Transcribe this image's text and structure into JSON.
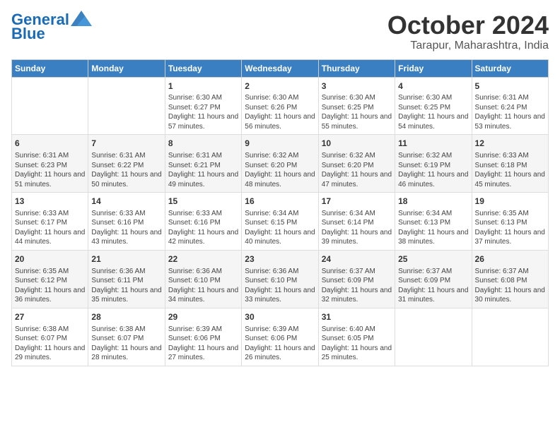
{
  "logo": {
    "line1": "General",
    "line2": "Blue"
  },
  "title": "October 2024",
  "subtitle": "Tarapur, Maharashtra, India",
  "weekdays": [
    "Sunday",
    "Monday",
    "Tuesday",
    "Wednesday",
    "Thursday",
    "Friday",
    "Saturday"
  ],
  "weeks": [
    [
      {
        "day": "",
        "data": ""
      },
      {
        "day": "",
        "data": ""
      },
      {
        "day": "1",
        "data": "Sunrise: 6:30 AM\nSunset: 6:27 PM\nDaylight: 11 hours and 57 minutes."
      },
      {
        "day": "2",
        "data": "Sunrise: 6:30 AM\nSunset: 6:26 PM\nDaylight: 11 hours and 56 minutes."
      },
      {
        "day": "3",
        "data": "Sunrise: 6:30 AM\nSunset: 6:25 PM\nDaylight: 11 hours and 55 minutes."
      },
      {
        "day": "4",
        "data": "Sunrise: 6:30 AM\nSunset: 6:25 PM\nDaylight: 11 hours and 54 minutes."
      },
      {
        "day": "5",
        "data": "Sunrise: 6:31 AM\nSunset: 6:24 PM\nDaylight: 11 hours and 53 minutes."
      }
    ],
    [
      {
        "day": "6",
        "data": "Sunrise: 6:31 AM\nSunset: 6:23 PM\nDaylight: 11 hours and 51 minutes."
      },
      {
        "day": "7",
        "data": "Sunrise: 6:31 AM\nSunset: 6:22 PM\nDaylight: 11 hours and 50 minutes."
      },
      {
        "day": "8",
        "data": "Sunrise: 6:31 AM\nSunset: 6:21 PM\nDaylight: 11 hours and 49 minutes."
      },
      {
        "day": "9",
        "data": "Sunrise: 6:32 AM\nSunset: 6:20 PM\nDaylight: 11 hours and 48 minutes."
      },
      {
        "day": "10",
        "data": "Sunrise: 6:32 AM\nSunset: 6:20 PM\nDaylight: 11 hours and 47 minutes."
      },
      {
        "day": "11",
        "data": "Sunrise: 6:32 AM\nSunset: 6:19 PM\nDaylight: 11 hours and 46 minutes."
      },
      {
        "day": "12",
        "data": "Sunrise: 6:33 AM\nSunset: 6:18 PM\nDaylight: 11 hours and 45 minutes."
      }
    ],
    [
      {
        "day": "13",
        "data": "Sunrise: 6:33 AM\nSunset: 6:17 PM\nDaylight: 11 hours and 44 minutes."
      },
      {
        "day": "14",
        "data": "Sunrise: 6:33 AM\nSunset: 6:16 PM\nDaylight: 11 hours and 43 minutes."
      },
      {
        "day": "15",
        "data": "Sunrise: 6:33 AM\nSunset: 6:16 PM\nDaylight: 11 hours and 42 minutes."
      },
      {
        "day": "16",
        "data": "Sunrise: 6:34 AM\nSunset: 6:15 PM\nDaylight: 11 hours and 40 minutes."
      },
      {
        "day": "17",
        "data": "Sunrise: 6:34 AM\nSunset: 6:14 PM\nDaylight: 11 hours and 39 minutes."
      },
      {
        "day": "18",
        "data": "Sunrise: 6:34 AM\nSunset: 6:13 PM\nDaylight: 11 hours and 38 minutes."
      },
      {
        "day": "19",
        "data": "Sunrise: 6:35 AM\nSunset: 6:13 PM\nDaylight: 11 hours and 37 minutes."
      }
    ],
    [
      {
        "day": "20",
        "data": "Sunrise: 6:35 AM\nSunset: 6:12 PM\nDaylight: 11 hours and 36 minutes."
      },
      {
        "day": "21",
        "data": "Sunrise: 6:36 AM\nSunset: 6:11 PM\nDaylight: 11 hours and 35 minutes."
      },
      {
        "day": "22",
        "data": "Sunrise: 6:36 AM\nSunset: 6:10 PM\nDaylight: 11 hours and 34 minutes."
      },
      {
        "day": "23",
        "data": "Sunrise: 6:36 AM\nSunset: 6:10 PM\nDaylight: 11 hours and 33 minutes."
      },
      {
        "day": "24",
        "data": "Sunrise: 6:37 AM\nSunset: 6:09 PM\nDaylight: 11 hours and 32 minutes."
      },
      {
        "day": "25",
        "data": "Sunrise: 6:37 AM\nSunset: 6:09 PM\nDaylight: 11 hours and 31 minutes."
      },
      {
        "day": "26",
        "data": "Sunrise: 6:37 AM\nSunset: 6:08 PM\nDaylight: 11 hours and 30 minutes."
      }
    ],
    [
      {
        "day": "27",
        "data": "Sunrise: 6:38 AM\nSunset: 6:07 PM\nDaylight: 11 hours and 29 minutes."
      },
      {
        "day": "28",
        "data": "Sunrise: 6:38 AM\nSunset: 6:07 PM\nDaylight: 11 hours and 28 minutes."
      },
      {
        "day": "29",
        "data": "Sunrise: 6:39 AM\nSunset: 6:06 PM\nDaylight: 11 hours and 27 minutes."
      },
      {
        "day": "30",
        "data": "Sunrise: 6:39 AM\nSunset: 6:06 PM\nDaylight: 11 hours and 26 minutes."
      },
      {
        "day": "31",
        "data": "Sunrise: 6:40 AM\nSunset: 6:05 PM\nDaylight: 11 hours and 25 minutes."
      },
      {
        "day": "",
        "data": ""
      },
      {
        "day": "",
        "data": ""
      }
    ]
  ]
}
